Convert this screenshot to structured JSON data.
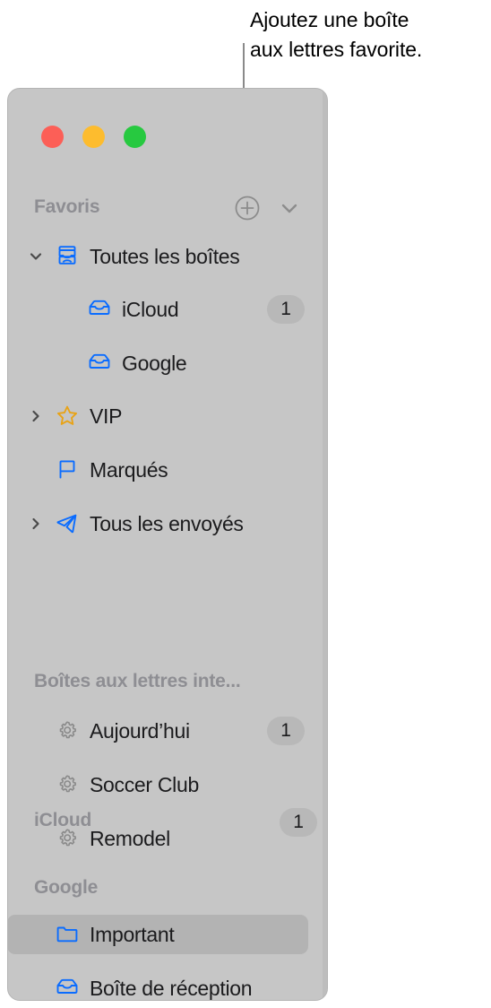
{
  "callout": {
    "text": "Ajoutez une boîte\naux lettres favorite."
  },
  "window": {
    "traffic_lights": [
      {
        "name": "close",
        "color": "#fc5f57"
      },
      {
        "name": "minimize",
        "color": "#fdbc2e"
      },
      {
        "name": "zoom",
        "color": "#27c940"
      }
    ]
  },
  "sidebar": {
    "favorites_header": {
      "title": "Favoris",
      "add_icon": "plus-circle-icon",
      "collapse_icon": "chevron-down-icon"
    },
    "favorites": [
      {
        "label": "Toutes les boîtes",
        "icon": "all-inboxes-icon",
        "disclosure": "expanded",
        "badge": "",
        "level": 0
      },
      {
        "label": "iCloud",
        "icon": "inbox-tray-icon",
        "disclosure": "",
        "badge": "1",
        "level": 1
      },
      {
        "label": "Google",
        "icon": "inbox-tray-icon",
        "disclosure": "",
        "badge": "",
        "level": 1
      },
      {
        "label": "VIP",
        "icon": "star-icon",
        "disclosure": "collapsed",
        "badge": "",
        "level": 0
      },
      {
        "label": "Marqués",
        "icon": "flag-icon",
        "disclosure": "",
        "badge": "",
        "level": 0
      },
      {
        "label": "Tous les envoyés",
        "icon": "paper-plane-icon",
        "disclosure": "collapsed",
        "badge": "",
        "level": 0
      }
    ],
    "smart_header": {
      "title": "Boîtes aux lettres inte..."
    },
    "smart_mailboxes": [
      {
        "label": "Aujourd’hui",
        "icon": "gear-icon",
        "badge": "1"
      },
      {
        "label": "Soccer Club",
        "icon": "gear-icon",
        "badge": ""
      },
      {
        "label": "Remodel",
        "icon": "gear-icon",
        "badge": ""
      }
    ],
    "icloud_header": {
      "title": "iCloud",
      "badge": "1"
    },
    "google_header": {
      "title": "Google",
      "badge": ""
    },
    "google_mailboxes": [
      {
        "label": "Important",
        "icon": "folder-icon",
        "badge": "",
        "selected": true
      },
      {
        "label": "Boîte de réception",
        "icon": "inbox-tray-icon",
        "badge": "",
        "selected": false
      }
    ]
  },
  "colors": {
    "sidebar_bg": "#c6c6c6",
    "selection": "#b3b3b3",
    "accent_blue": "#0a6cff",
    "star_gold": "#e8a317",
    "header_gray": "#8e8e93",
    "text": "#1b1b1d"
  }
}
